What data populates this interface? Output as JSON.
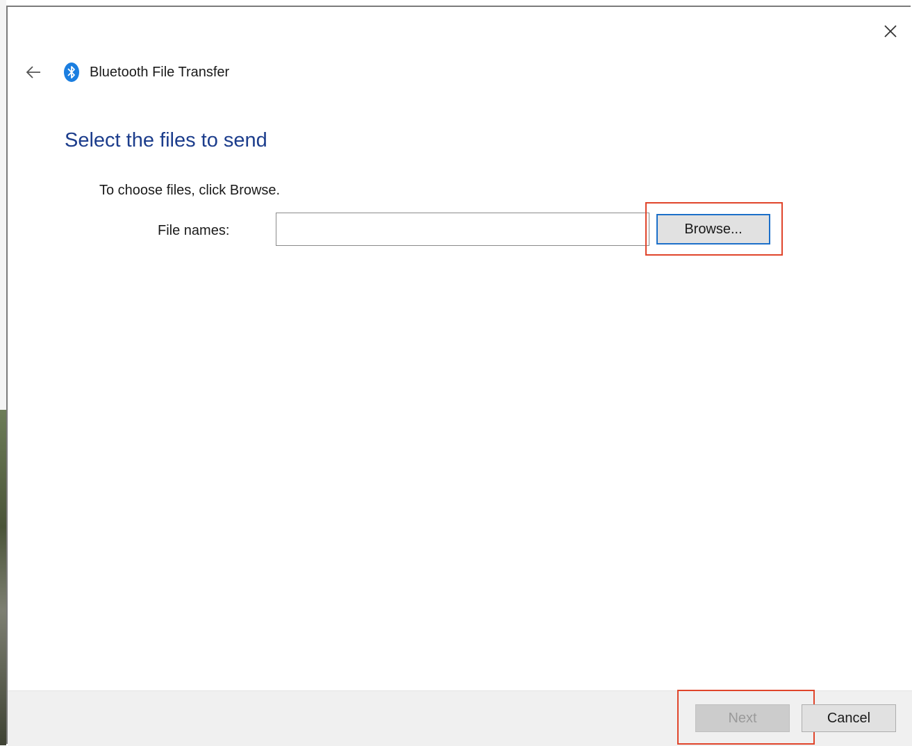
{
  "window": {
    "title": "Bluetooth File Transfer",
    "close_icon": "close-icon",
    "back_icon": "back-arrow-icon",
    "app_icon": "bluetooth-icon"
  },
  "main": {
    "heading": "Select the files to send",
    "instructions": "To choose files, click Browse.",
    "file_names_label": "File names:",
    "file_names_value": "",
    "browse_label": "Browse..."
  },
  "footer": {
    "next_label": "Next",
    "next_enabled": false,
    "cancel_label": "Cancel"
  },
  "colors": {
    "heading": "#1c3d8c",
    "bluetooth": "#1b7ee0",
    "focus_border": "#1b6fc9",
    "highlight": "#e0442a"
  }
}
